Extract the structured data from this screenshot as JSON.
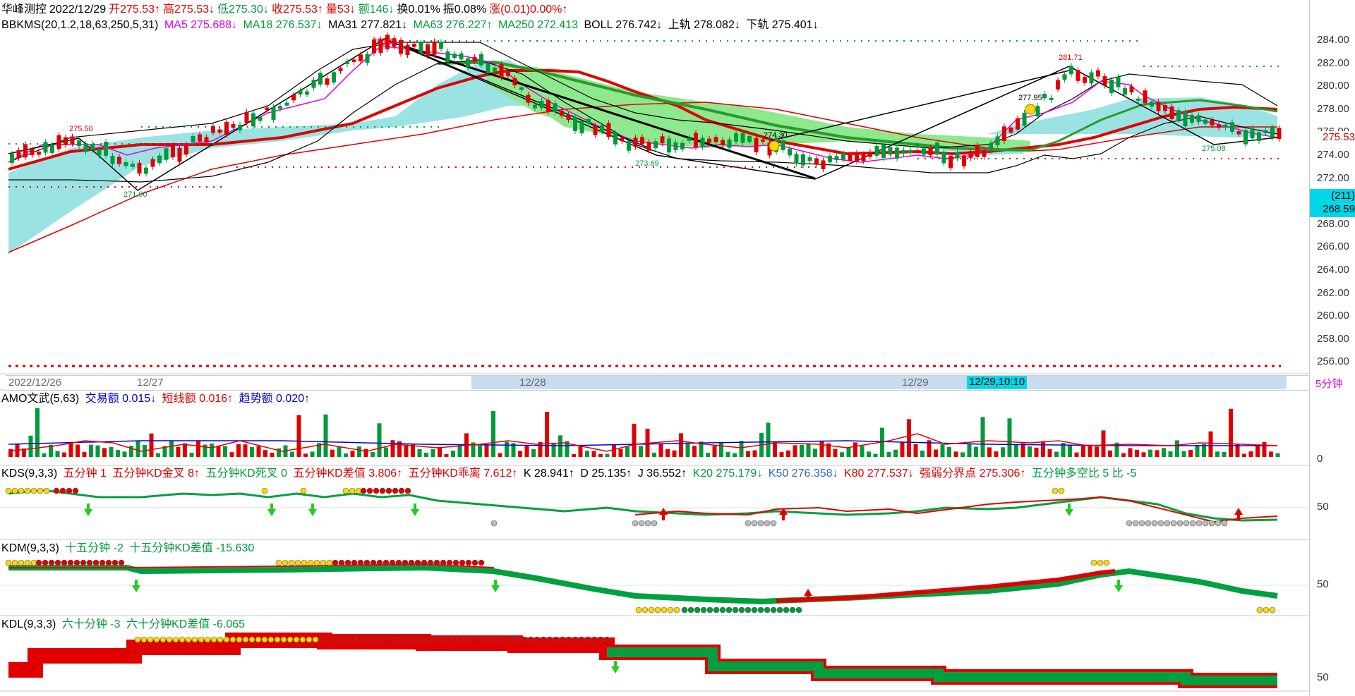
{
  "header": {
    "stock_name": "华峰测控",
    "date": "2022/12/29",
    "open": "开275.53↑",
    "high": "高275.53↓",
    "low": "低275.30↓",
    "close": "收275.53↑",
    "volume": "量53↓",
    "amount": "额146↓",
    "turnover": "换0.01%",
    "amplitude": "振0.08%",
    "change": "涨(0.01)0.00%↑"
  },
  "main_indicator": {
    "name": "BBKMS(20,1.2,18,63,250,5,31)",
    "ma5": "MA5 275.688↓",
    "ma18": "MA18 276.537↓",
    "ma31": "MA31 277.821↓",
    "ma63": "MA63 276.227↑",
    "ma250": "MA250 272.413",
    "boll": "BOLL 276.742↓",
    "upper": "上轨 278.082↓",
    "lower": "下轨 275.401↓"
  },
  "price_axis": [
    "284.00",
    "282.00",
    "280.00",
    "278.00",
    "276.00",
    "274.00",
    "272.00",
    "270.00",
    "268.00",
    "266.00",
    "264.00",
    "262.00",
    "260.00",
    "258.00",
    "256.00"
  ],
  "price_tag": "275.53",
  "cursor_tag": {
    "count": "(211)",
    "value": "268.59"
  },
  "annotations": {
    "p1": "275.50",
    "p2": "271.00",
    "p3": "283.80",
    "p4": "273.69",
    "p5": "274.30",
    "p6": "277.95",
    "p7": "281.71",
    "p8": "275.08"
  },
  "date_axis": {
    "d1": "2022/12/26",
    "d2": "12/27",
    "d3": "12/28",
    "d4": "12/29",
    "cursor": "12/29,10:10",
    "period": "5分钟"
  },
  "amo": {
    "name": "AMO文武(5,63)",
    "trade": "交易额 0.015↓",
    "short": "短线额 0.016↑",
    "trend": "趋势额 0.020↑",
    "axis": "0"
  },
  "kds": {
    "name": "KDS(9,3,3)",
    "items": [
      "五分钟 1",
      "五分钟KD金叉 8↑",
      "五分钟KD死叉 0",
      "五分钟KD差值 3.806↑",
      "五分钟KD乖离 7.612↑"
    ],
    "k": "K 28.941↑",
    "d": "D 25.135↑",
    "j": "J 36.552↑",
    "k20": "K20 275.179↓",
    "k50": "K50 276.358↓",
    "k80": "K80 277.537↓",
    "strong": "强弱分界点 275.306↑",
    "ratio": "五分钟多空比 5  比 -5",
    "axis": "50"
  },
  "kdm": {
    "name": "KDM(9,3,3)",
    "a": "十五分钟 -2",
    "b": "十五分钟KD差值 -15.630",
    "axis": "50"
  },
  "kdl": {
    "name": "KDL(9,3,3)",
    "a": "六十分钟 -3",
    "b": "六十分钟KD差值 -6.065",
    "axis": "50"
  },
  "colors": {
    "up": "#e00000",
    "down": "#009a3a",
    "bb_fill": "#9be3e3",
    "green_fill": "#8ee88e"
  }
}
